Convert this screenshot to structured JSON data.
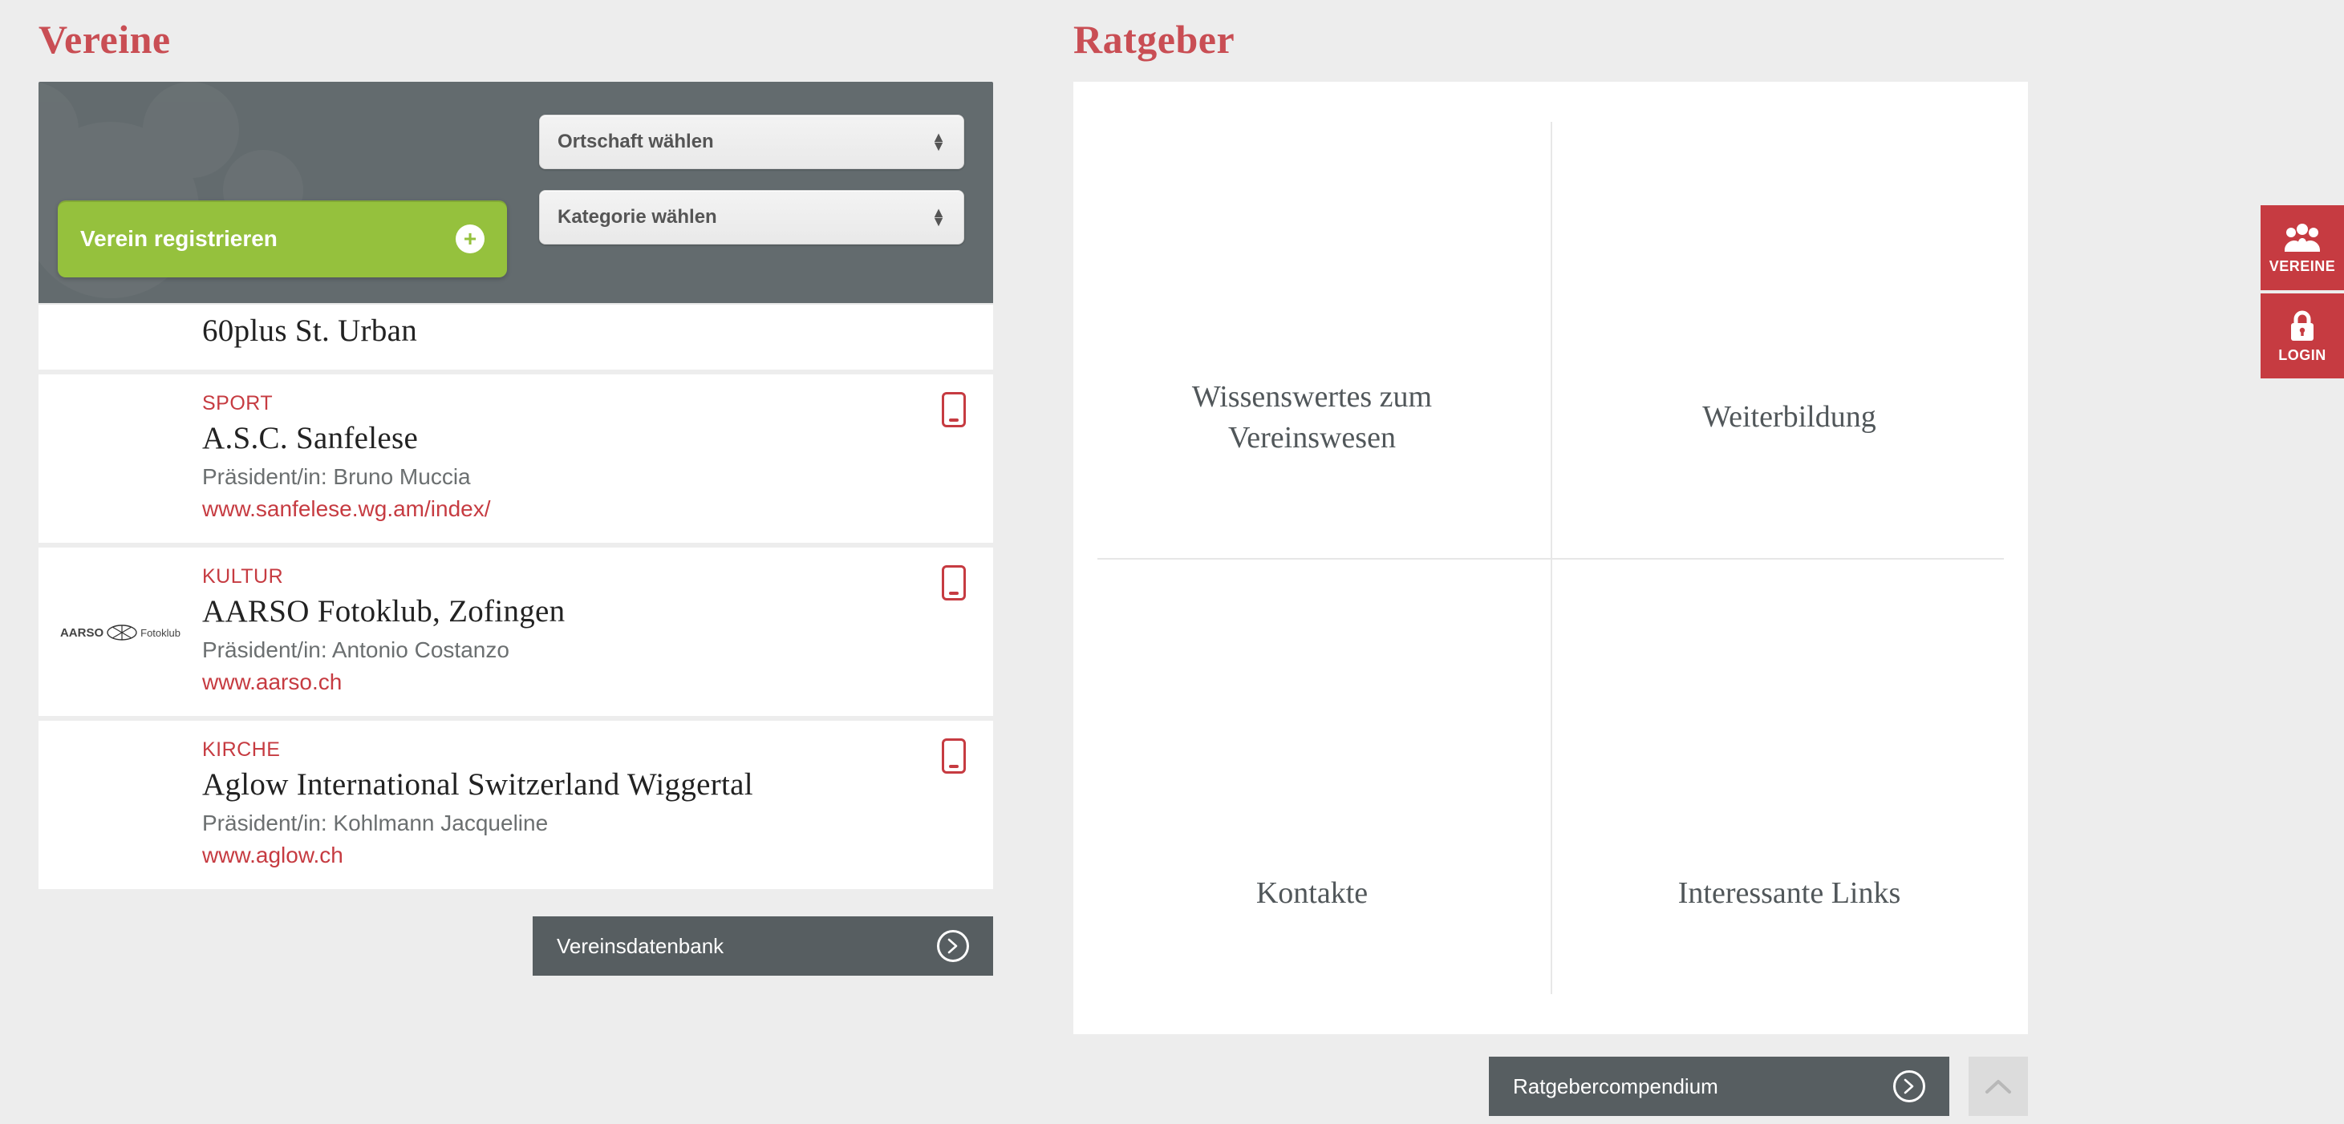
{
  "colors": {
    "accent": "#c94e54",
    "green": "#95c13d",
    "darkgrey": "#636b6e"
  },
  "vereine": {
    "title": "Vereine",
    "register_label": "Verein registrieren",
    "select_location": "Ortschaft wählen",
    "select_category": "Kategorie wählen",
    "footer_label": "Vereinsdatenbank",
    "items": [
      {
        "name": "60plus St. Urban"
      },
      {
        "category": "SPORT",
        "name": "A.S.C. Sanfelese",
        "president": "Präsident/in: Bruno Muccia",
        "url": "www.sanfelese.wg.am/index/"
      },
      {
        "category": "KULTUR",
        "name": "AARSO Fotoklub, Zofingen",
        "president": "Präsident/in: Antonio Costanzo",
        "url": "www.aarso.ch",
        "thumb": "AARSO Fotoklub"
      },
      {
        "category": "KIRCHE",
        "name": "Aglow International Switzerland Wiggertal",
        "president": "Präsident/in: Kohlmann Jacqueline",
        "url": "www.aglow.ch"
      }
    ]
  },
  "ratgeber": {
    "title": "Ratgeber",
    "footer_label": "Ratgebercompendium",
    "cells": [
      "Wissenswertes zum Vereinswesen",
      "Weiterbildung",
      "Kontakte",
      "Interessante Links"
    ]
  },
  "sidefab": {
    "vereine": "VEREINE",
    "login": "LOGIN"
  }
}
